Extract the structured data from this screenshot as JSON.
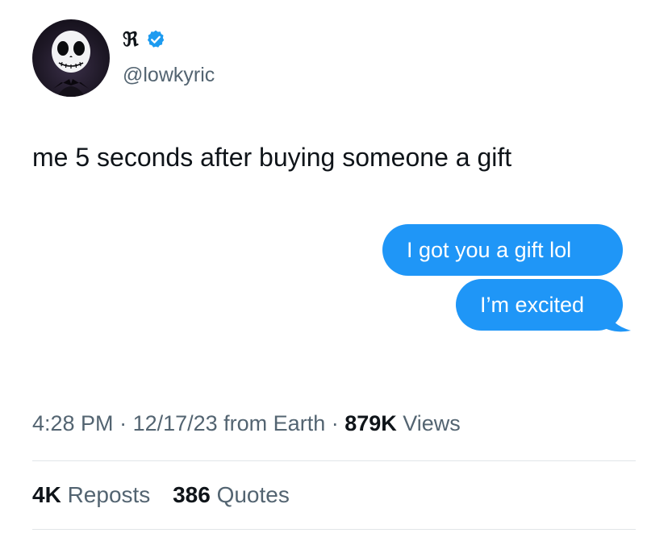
{
  "author": {
    "display_name": "ℜ",
    "handle": "@lowkyric",
    "verified": true,
    "avatar_icon": "skeleton-avatar-icon"
  },
  "tweet": {
    "text": "me 5 seconds after buying someone a gift"
  },
  "messages": [
    {
      "text": "I got you a gift lol"
    },
    {
      "text": "I’m excited"
    }
  ],
  "meta": {
    "time": "4:28 PM",
    "separator": " · ",
    "date": "12/17/23",
    "location": " from Earth",
    "views_count": "879K",
    "views_label": " Views"
  },
  "stats": {
    "reposts_count": "4K",
    "reposts_label": "Reposts",
    "quotes_count": "386",
    "quotes_label": "Quotes"
  },
  "colors": {
    "bubble_blue": "#1f96f7",
    "verified_blue": "#1d9bf0",
    "muted_text": "#536471",
    "primary_text": "#0f1419"
  }
}
